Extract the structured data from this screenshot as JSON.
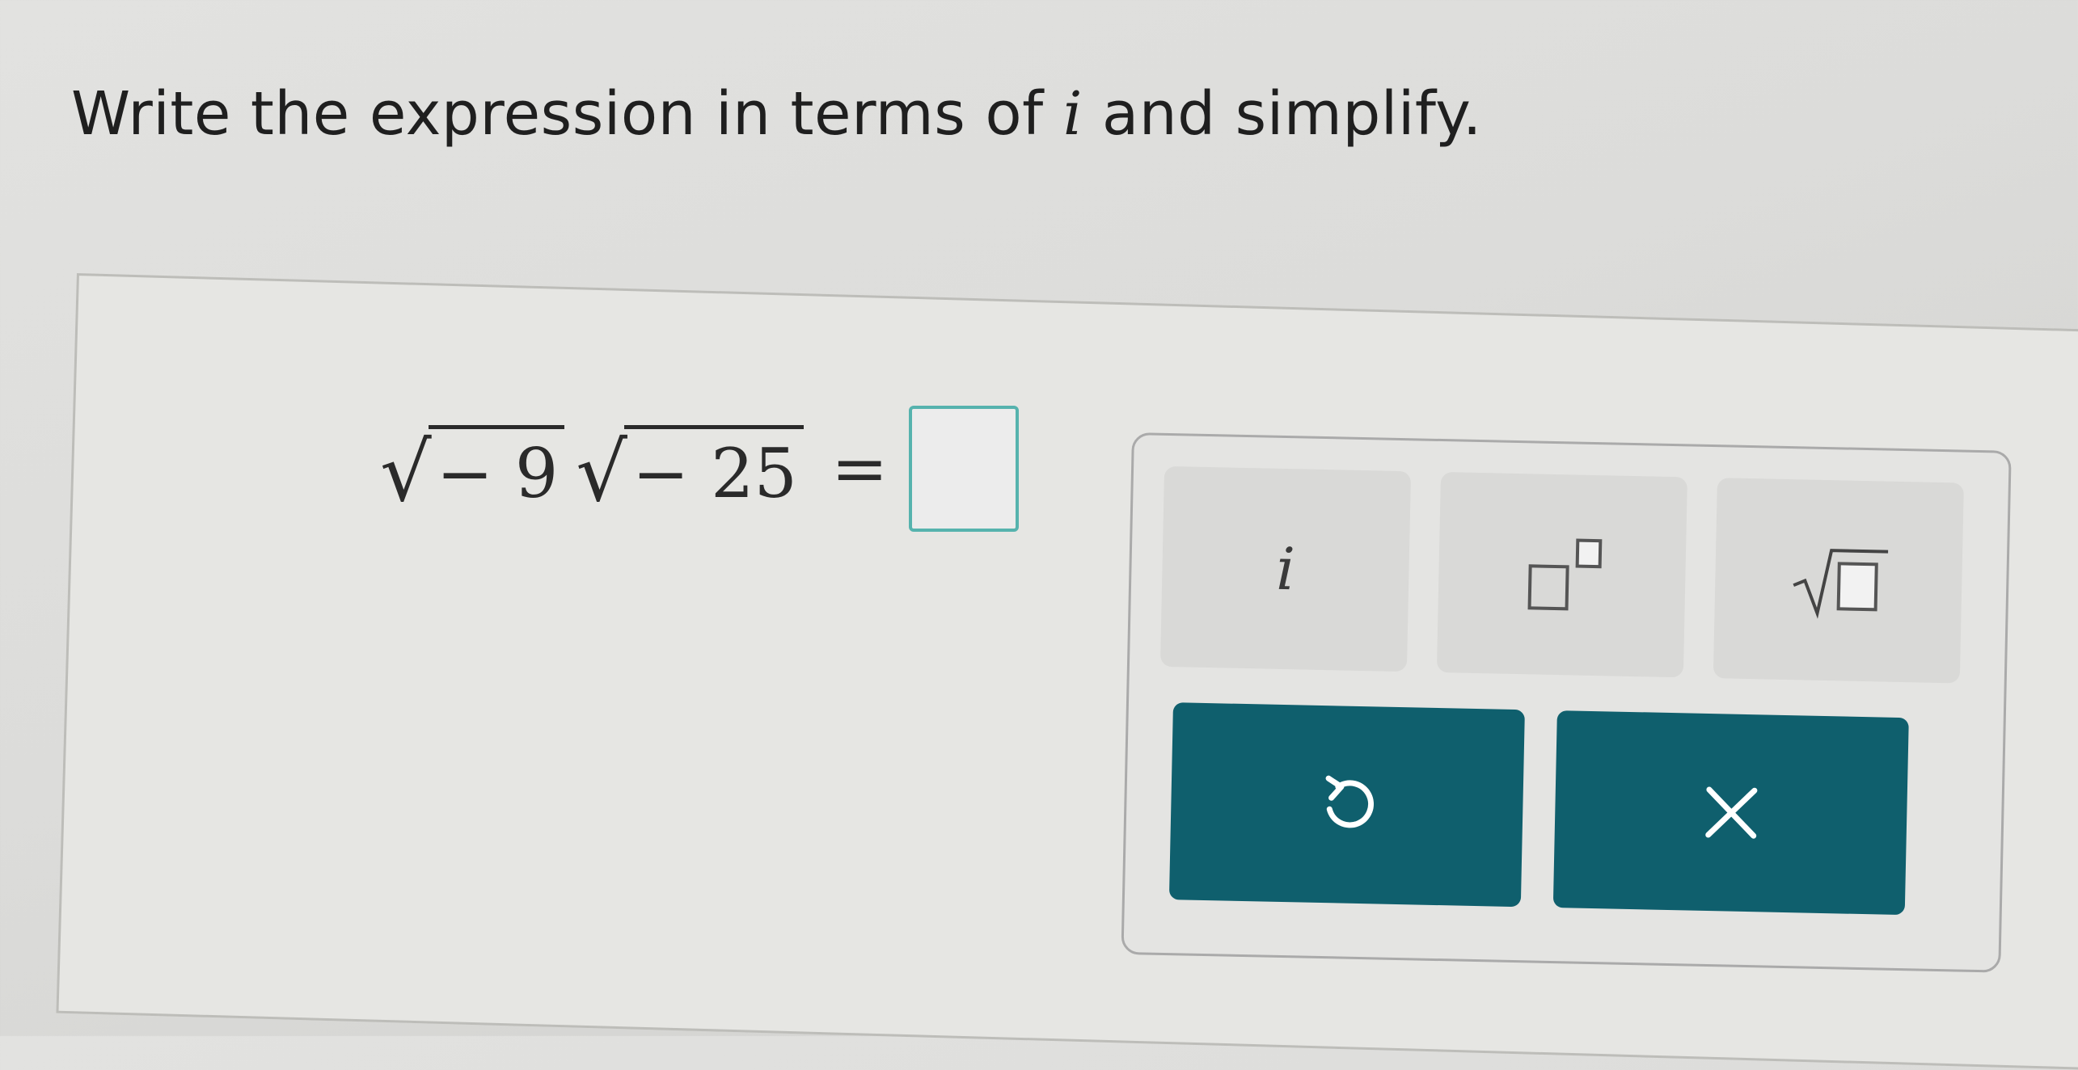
{
  "prompt": {
    "text_before": "Write the expression in terms of ",
    "variable": "i",
    "text_after": " and simplify."
  },
  "equation": {
    "radicand_1": "− 9",
    "radicand_2": "− 25",
    "equals": "=",
    "answer_value": ""
  },
  "keypad": {
    "key_i_label": "i",
    "icons": [
      "imaginary-unit",
      "exponent-template-icon",
      "square-root-template-icon",
      "undo-icon",
      "clear-icon"
    ],
    "accent_color": "#0f5f6d",
    "answer_border_color": "#56b3ae"
  }
}
